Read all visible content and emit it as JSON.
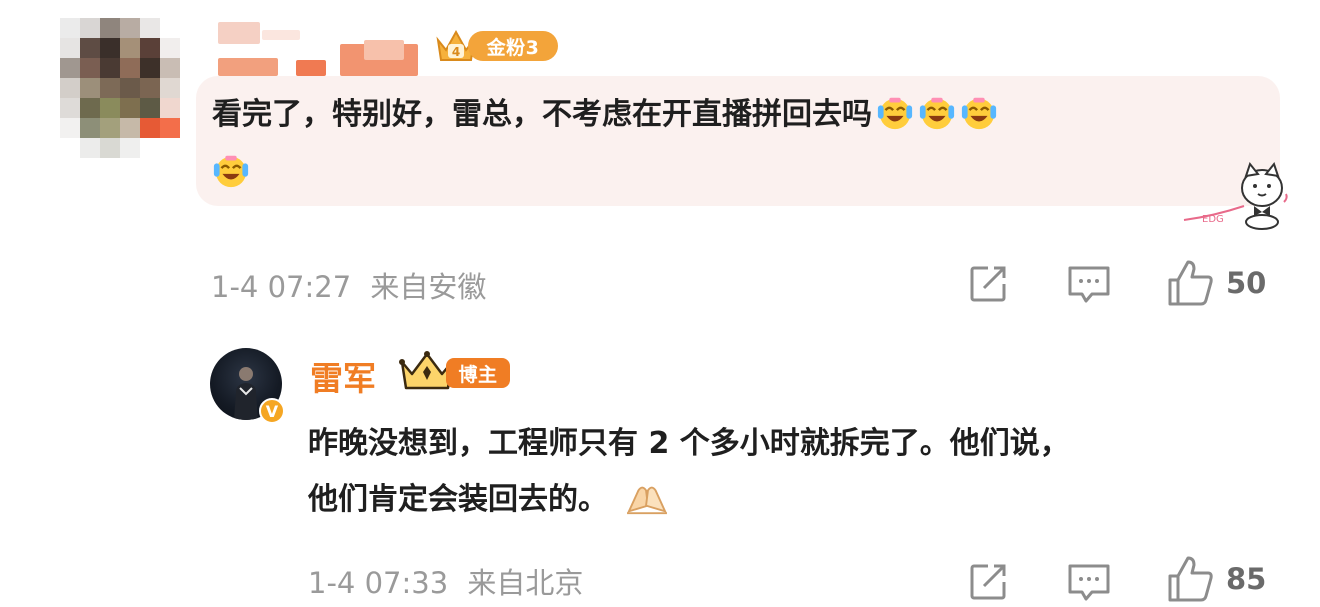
{
  "comment": {
    "user": {
      "name_censored": true,
      "fan_badge": {
        "label": "金粉3",
        "color": "#f3a43a"
      }
    },
    "text_line1": "看完了，特别好，雷总，不考虑在开直播拼回去吗",
    "emoji_name": "laugh-cry-emoji",
    "timestamp": "1-4 07:27",
    "location": "来自安徽",
    "like_count": "50"
  },
  "reply": {
    "user": {
      "name": "雷军",
      "role_badge": "博主",
      "verified_badge": "V"
    },
    "text_line1": "昨晚没想到，工程师只有 2 个多小时就拆完了。他们说，",
    "text_line2": "他们肯定会装回去的。",
    "emoji_name": "praying-hands-emoji",
    "timestamp": "1-4 07:33",
    "location": "来自北京",
    "like_count": "85"
  },
  "icons": [
    "share-icon",
    "comment-icon",
    "like-icon"
  ],
  "colors": {
    "accent_orange": "#f07d24",
    "bubble_bg": "#fbf1ef",
    "meta_gray": "#9a9a9a"
  }
}
